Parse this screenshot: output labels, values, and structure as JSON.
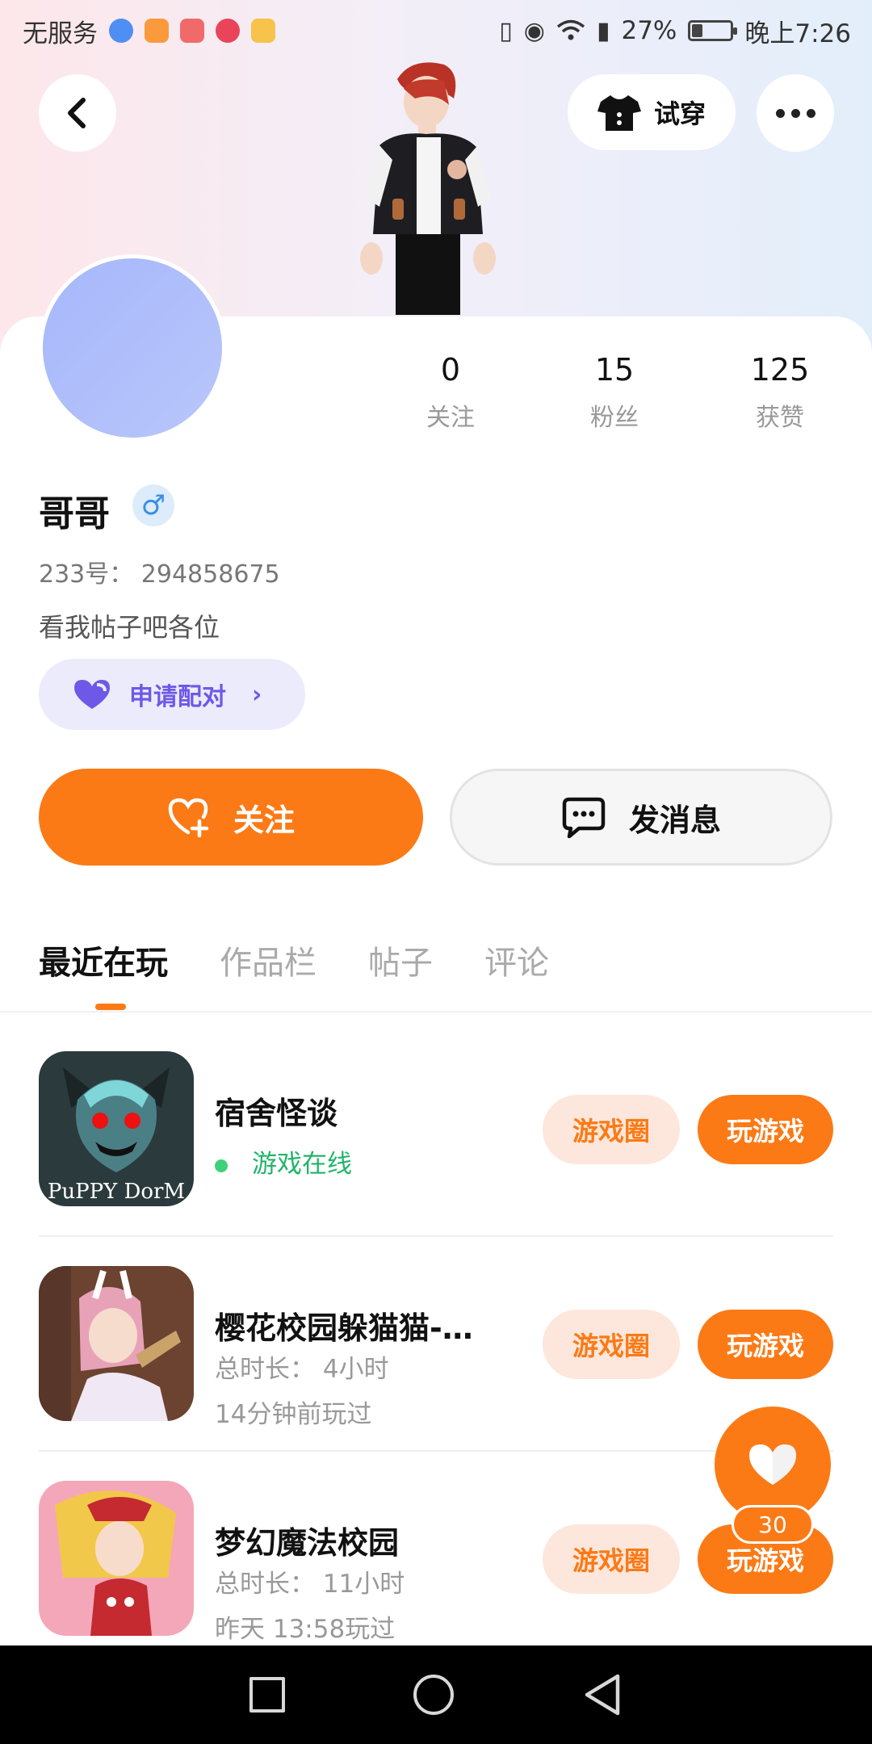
{
  "status_bar": {
    "carrier": "无服务",
    "battery_text": "27%",
    "battery_level": 0.27,
    "time": "晚上7:26"
  },
  "header": {
    "try_on_label": "试穿"
  },
  "profile": {
    "stats": [
      {
        "value": "0",
        "label": "关注"
      },
      {
        "value": "15",
        "label": "粉丝"
      },
      {
        "value": "125",
        "label": "获赞"
      }
    ],
    "username": "哥哥",
    "gender_symbol": "♂",
    "id_text": "233号： 294858675",
    "bio": "看我帖子吧各位",
    "pair_label": "申请配对",
    "pair_chevron": "›",
    "follow_label": "关注",
    "message_label": "发消息"
  },
  "tabs": [
    {
      "label": "最近在玩",
      "active": true
    },
    {
      "label": "作品栏",
      "active": false
    },
    {
      "label": "帖子",
      "active": false
    },
    {
      "label": "评论",
      "active": false
    }
  ],
  "games": [
    {
      "title": "宿舍怪谈",
      "status": "游戏在线",
      "circle_label": "游戏圈",
      "play_label": "玩游戏",
      "icon_text": "PuPPY DorM"
    },
    {
      "title": "樱花校园躲猫猫-…",
      "duration": "总时长：  4小时",
      "last_played": "14分钟前玩过",
      "circle_label": "游戏圈",
      "play_label": "玩游戏"
    },
    {
      "title": "梦幻魔法校园",
      "duration": "总时长：  11小时",
      "last_played": "昨天  13:58玩过",
      "circle_label": "游戏圈",
      "play_label": "玩游戏"
    }
  ],
  "float_like": {
    "count": "30"
  },
  "colors": {
    "accent": "#fb7a16",
    "accent_light": "#fde7dc",
    "pair_purple": "#6e58e8",
    "online_green": "#21b46a",
    "avatar_blue": "#a6b7fb"
  }
}
